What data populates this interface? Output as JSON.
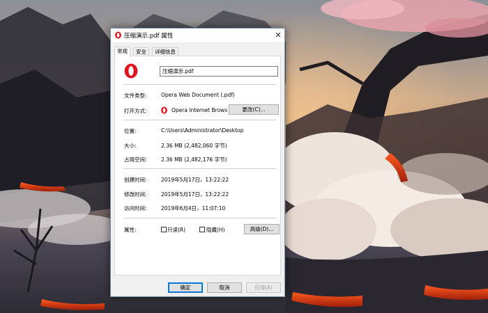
{
  "window": {
    "title": "压缩演示.pdf 属性",
    "close_glyph": "✕"
  },
  "tabs": [
    {
      "label": "常规",
      "active": true
    },
    {
      "label": "安全",
      "active": false
    },
    {
      "label": "详细信息",
      "active": false
    }
  ],
  "general": {
    "file_name": "压缩演示.pdf",
    "file_type_label": "文件类型:",
    "file_type_value": "Opera Web Document (.pdf)",
    "open_with_label": "打开方式:",
    "open_with_value": "Opera Internet Browse",
    "change_button": "更改(C)...",
    "location_label": "位置:",
    "location_value": "C:\\Users\\Administrator\\Desktop",
    "size_label": "大小:",
    "size_value": "2.36 MB (2,482,060 字节)",
    "size_on_disk_label": "占用空间:",
    "size_on_disk_value": "2.36 MB (2,482,176 字节)",
    "created_label": "创建时间:",
    "created_value": "2019年5月17日，13:22:22",
    "modified_label": "修改时间:",
    "modified_value": "2019年5月17日，13:22:22",
    "accessed_label": "访问时间:",
    "accessed_value": "2019年6月4日，11:07:10",
    "attributes_label": "属性:",
    "readonly_label": "只读(R)",
    "readonly_checked": false,
    "hidden_label": "隐藏(H)",
    "hidden_checked": false,
    "advanced_button": "高级(D)..."
  },
  "footer": {
    "ok_button": "确定",
    "cancel_button": "取消",
    "apply_button": "应用(A)",
    "apply_enabled": false
  },
  "icons": {
    "app_icon": "opera-icon",
    "brand_color": "#e0141e"
  }
}
